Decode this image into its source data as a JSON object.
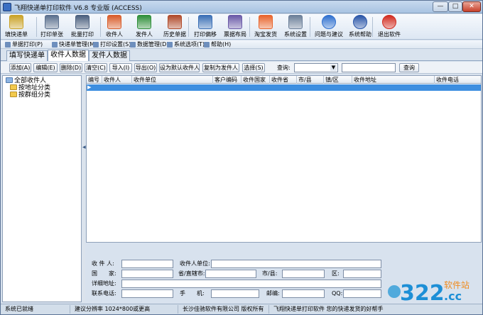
{
  "window": {
    "title": "飞翔快递单打印软件 V6.8 专业版 (ACCESS)"
  },
  "window_controls": {
    "minimize": "—",
    "maximize": "□",
    "close": "✕"
  },
  "toolbar": [
    {
      "name": "fill-waybill",
      "label": "填快递单",
      "icon": "pen-icon",
      "color": "#c9a227"
    },
    {
      "name": "print-single",
      "label": "打印单张",
      "icon": "printer-icon",
      "color": "#5a6f8e"
    },
    {
      "name": "batch-print",
      "label": "批量打印",
      "icon": "printer-stack-icon",
      "color": "#4a5f7e"
    },
    {
      "name": "recipient",
      "label": "收件人",
      "icon": "recipient-user-icon",
      "color": "#d85c2a"
    },
    {
      "name": "sender",
      "label": "发件人",
      "icon": "sender-user-icon",
      "color": "#2f8f3a"
    },
    {
      "name": "history",
      "label": "历史单据",
      "icon": "history-icon",
      "color": "#b04a2a"
    },
    {
      "name": "print-offset",
      "label": "打印偏移",
      "icon": "offset-icon",
      "color": "#3b6fb6"
    },
    {
      "name": "layout",
      "label": "票据布局",
      "icon": "layout-icon",
      "color": "#6a5aa8"
    },
    {
      "name": "taobao-ship",
      "label": "淘宝发货",
      "icon": "taobao-icon",
      "color": "#e8642c"
    },
    {
      "name": "settings",
      "label": "系统设置",
      "icon": "gear-icon",
      "color": "#6b7f99"
    },
    {
      "name": "feedback",
      "label": "问题与建议",
      "icon": "info-icon",
      "color": "#2e6fcf"
    },
    {
      "name": "help",
      "label": "系统帮助",
      "icon": "help-icon",
      "color": "#2955a8"
    },
    {
      "name": "exit",
      "label": "退出软件",
      "icon": "close-icon",
      "color": "#d12a1e"
    }
  ],
  "menu": [
    "单据打印(P)",
    "快递单管理(M)",
    "打印设置(S)",
    "数据管理(D)",
    "系统选项(T)",
    "帮助(H)"
  ],
  "tabs": [
    {
      "label": "填写快递单",
      "active": false
    },
    {
      "label": "收件人数据",
      "active": true
    },
    {
      "label": "发件人数据",
      "active": false
    }
  ],
  "actions": {
    "add": "添加(A)",
    "edit": "编辑(E)",
    "delete": "删除(D)",
    "clear": "清空(C)",
    "import": "导入(I)",
    "export": "导出(O)",
    "set_default": "设为默认收件人",
    "copy_to_sender": "复制为发件人",
    "select": "选择(S)",
    "query_label": "查询:",
    "query_field_value": "",
    "query_text_value": "",
    "query_button": "查询"
  },
  "tree": {
    "items": [
      "全部收件人",
      "按地址分类",
      "按群组分类"
    ]
  },
  "grid": {
    "columns": [
      "编号",
      "收件人",
      "收件单位",
      "客户编码",
      "收件国家",
      "收件省",
      "市/县",
      "镇/区",
      "收件地址",
      "收件电话"
    ],
    "rows": []
  },
  "form": {
    "recipient": "收 件 人:",
    "company": "收件人单位:",
    "country": "国　　家:",
    "province": "省/直辖市:",
    "city": "市/县:",
    "district": "区:",
    "address": "详细地址:",
    "phone": "联系电话:",
    "mobile": "手　　机:",
    "postcode": "邮编:",
    "qq": "QQ:"
  },
  "status": [
    "系统已就绪",
    "建议分辨率 1024*800或更高",
    "长沙佳驰软件有限公司 版权所有",
    "飞翔快递单打印软件 您的快递发货的好帮手"
  ],
  "watermark": {
    "number": "322",
    "brand": "软件站",
    "domain": ".cc"
  }
}
